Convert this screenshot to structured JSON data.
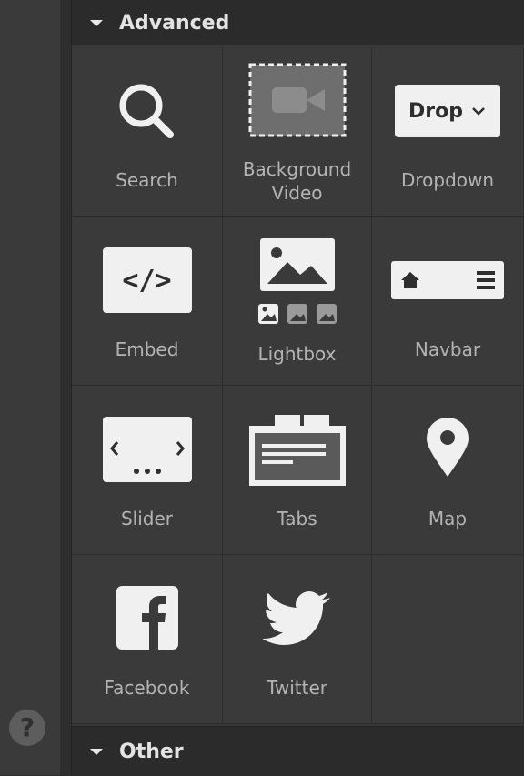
{
  "sections": {
    "advanced": {
      "label": "Advanced"
    },
    "other": {
      "label": "Other"
    }
  },
  "help": {
    "label": "?"
  },
  "elements": {
    "search": {
      "label": "Search",
      "icon": "search-icon"
    },
    "background_video": {
      "label": "Background\nVideo",
      "icon": "video-camera-icon"
    },
    "dropdown": {
      "label": "Dropdown",
      "icon": "dropdown-icon",
      "preview_text": "Drop"
    },
    "embed": {
      "label": "Embed",
      "icon": "code-icon",
      "preview_text": "</>"
    },
    "lightbox": {
      "label": "Lightbox",
      "icon": "image-gallery-icon"
    },
    "navbar": {
      "label": "Navbar",
      "icon": "navbar-icon"
    },
    "slider": {
      "label": "Slider",
      "icon": "slider-icon"
    },
    "tabs": {
      "label": "Tabs",
      "icon": "tabs-icon"
    },
    "map": {
      "label": "Map",
      "icon": "map-pin-icon"
    },
    "facebook": {
      "label": "Facebook",
      "icon": "facebook-icon"
    },
    "twitter": {
      "label": "Twitter",
      "icon": "twitter-icon"
    }
  },
  "colors": {
    "panel_bg": "#3a3a3a",
    "header_bg": "#2b2b2b",
    "icon_fill": "#f0f0f0",
    "label_text": "#b4b4b4"
  }
}
